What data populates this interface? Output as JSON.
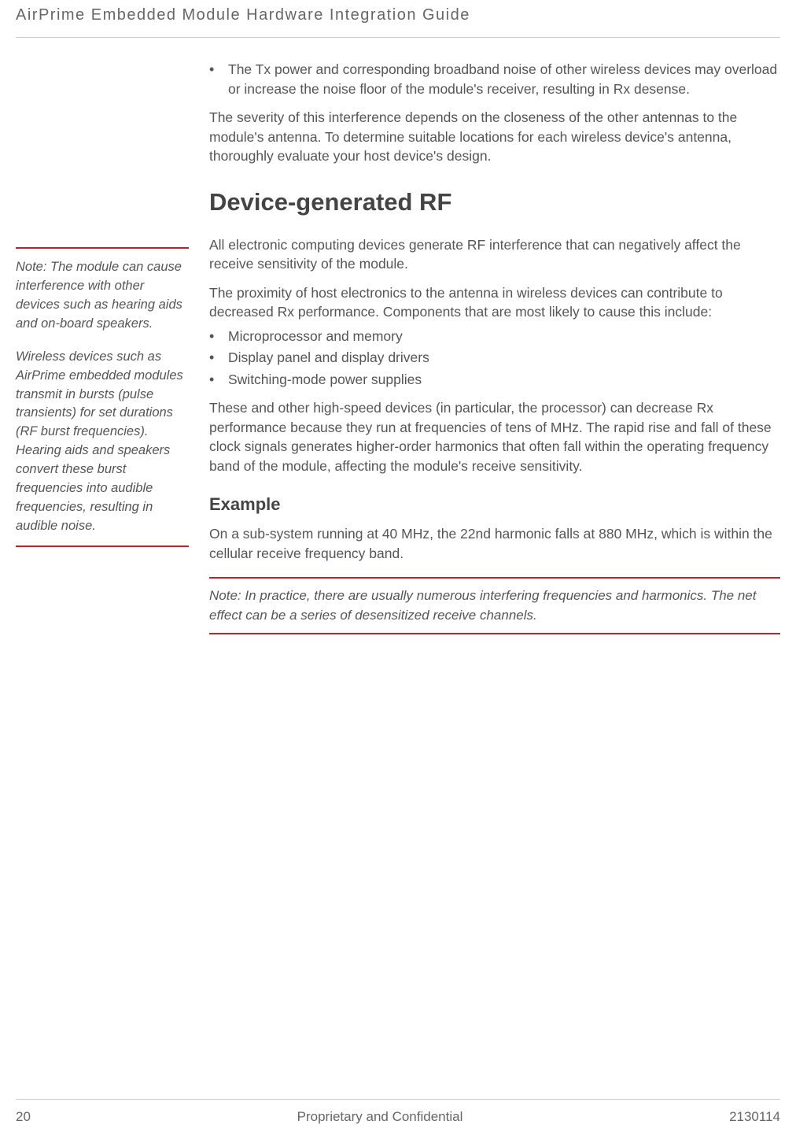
{
  "header": {
    "title": "AirPrime Embedded Module Hardware Integration Guide"
  },
  "sidebar_note": {
    "label": "Note:",
    "para1": " The module can cause interference with other devices such as hearing aids and on-board speakers.",
    "para2": "Wireless devices such as AirPrime embedded modules transmit in bursts (pulse transients) for set durations (RF burst frequencies). Hearing aids and speakers convert these burst frequencies into audible frequencies, resulting in audible noise."
  },
  "main": {
    "bullet_intro": "The Tx power and corresponding broadband noise of other wireless devices may overload or increase the noise floor of the module's receiver, resulting in Rx desense.",
    "para_severity": "The severity of this interference depends on the closeness of the other antennas to the module's antenna. To determine suitable locations for each wireless device's antenna, thoroughly evaluate your host device's design.",
    "heading_device_rf": "Device-generated RF",
    "para_intro_rf": "All electronic computing devices generate RF interference that can negatively affect the receive sensitivity of the module.",
    "para_proximity": "The proximity of host electronics to the antenna in wireless devices can contribute to decreased Rx performance. Components that are most likely to cause this include:",
    "component_list": [
      "Microprocessor and memory",
      "Display panel and display drivers",
      "Switching-mode power supplies"
    ],
    "para_highspeed": "These and other high-speed devices (in particular, the processor) can decrease Rx performance because they run at frequencies of tens of MHz. The rapid rise and fall of these clock signals generates higher-order harmonics that often fall within the operating frequency band of the module, affecting the module's receive sensitivity.",
    "heading_example": "Example",
    "para_example": "On a sub-system running at 40 MHz, the 22nd harmonic falls at 880 MHz, which is within the cellular receive frequency band.",
    "inline_note_label": "Note:",
    "inline_note_body": " In practice, there are usually numerous interfering frequencies and harmonics. The net effect can be a series of desensitized receive channels."
  },
  "footer": {
    "page_number": "20",
    "confidentiality": "Proprietary and Confidential",
    "doc_id": "2130114"
  }
}
